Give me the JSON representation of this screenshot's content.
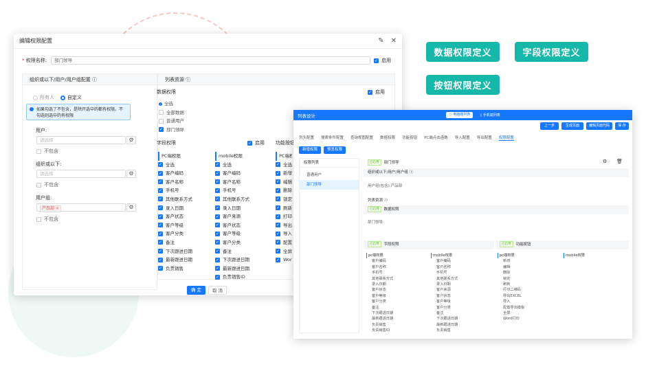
{
  "features": [
    "数据权限定义",
    "字段权限定义",
    "按钮权限定义"
  ],
  "dialog": {
    "title": "编辑权限配置",
    "name_label": "权限名称:",
    "name_value": "部门领导",
    "enable_label": "启用",
    "left_header": "组织或以下/用户/用户组配置",
    "right_header": "列表资源",
    "radio_all": "所有人",
    "radio_custom": "自定义",
    "info_line1": "如果勾选了不包含，是除开选中的都有权限。不",
    "info_line2": "勾选则选中的有权限",
    "user_label": "用户:",
    "user_placeholder": "请选择",
    "exclude1": "不包含",
    "org_label": "组织或以下:",
    "org_placeholder": "请选择",
    "exclude2": "不包含",
    "group_label": "用户组:",
    "group_tag": "产品部",
    "exclude3": "不包含",
    "data_perm_title": "数据权限",
    "data_perm_enable": "启用",
    "data_options": [
      "全选",
      "全部数据",
      "普通用户",
      "部门领导"
    ],
    "field_perm_title": "字段权限",
    "field_perm_enable": "启用",
    "func_title": "功能按钮",
    "pc_title": "PC端权限",
    "pc_fields": [
      "全选",
      "客户编码",
      "客户名称",
      "手机号",
      "其他联系方式",
      "录入日期",
      "客户状态",
      "客户等级",
      "客户分类",
      "备注",
      "下次跟进日期",
      "最新跟进日期",
      "负责销售"
    ],
    "mobile_title": "mobile权限",
    "mobile_fields": [
      "全选",
      "客户编码",
      "客户名称",
      "手机号",
      "其他联系方式",
      "录入日期",
      "客户来源",
      "客户状态",
      "客户等级",
      "客户分类",
      "备注",
      "下次跟进日期",
      "最新跟进日期",
      "负责销售ID"
    ],
    "func_items": [
      "全选",
      "新增",
      "编辑",
      "删除",
      "锁定",
      "刷新",
      "打印",
      "导出",
      "导入",
      "配置",
      "全屏",
      "Word"
    ],
    "ok": "确 定",
    "cancel": "取 消"
  },
  "win": {
    "title": "列表设计",
    "mode_pc": "电脑端列表",
    "mode_mobile": "手机端列表",
    "btn_prev": "上一步",
    "btn_gen": "生成页面",
    "btn_code": "编辑页面代码",
    "btn_save": "保 存",
    "tabs": [
      "列头配置",
      "搜索条件配置",
      "查询视图配置",
      "数据权限",
      "功能按钮",
      "PC端点击函数",
      "导入配置",
      "导出配置",
      "权限配置"
    ],
    "add_perm": "新增权限",
    "preview_perm": "预览权限",
    "perm_list": "权限列表",
    "perm_items": [
      "普通用户",
      "部门领导"
    ],
    "enabled": "已启用",
    "cur_name": "部门领导",
    "org_cfg": "组织或以下/用户/用户组",
    "org_cfg_val": "用户组(包含):产品部",
    "list_res": "列表资源",
    "data_perm": "数据权限",
    "data_perm_val": "部门领导",
    "field_perm": "字段权限",
    "func_btn": "功能按钮",
    "pc_title": "pc端权限",
    "pc_items": [
      "客户编码",
      "客户名称",
      "手机号",
      "其他联系方式",
      "录入日期",
      "客户状态",
      "客户等级",
      "客户分类",
      "备注",
      "下次跟进日期",
      "最新跟进日期",
      "负责销售",
      "负责销售ID"
    ],
    "mob_title": "mobile权限",
    "mob_items": [
      "客户编码",
      "客户名称",
      "手机号",
      "其他联系方式",
      "录入日期",
      "客户来源",
      "客户状态",
      "客户等级",
      "客户分类",
      "备注",
      "下次跟进日期",
      "最新跟进日期",
      "负责销售"
    ],
    "fpc_title": "pc端权限",
    "fpc_items": [
      "新增",
      "编辑",
      "删除",
      "锁定",
      "刷新",
      "打印二维码",
      "导出EXCEL",
      "导入",
      "配置导出模板",
      "全屏",
      "Word打印"
    ],
    "fmob_title": "mobile权限"
  }
}
